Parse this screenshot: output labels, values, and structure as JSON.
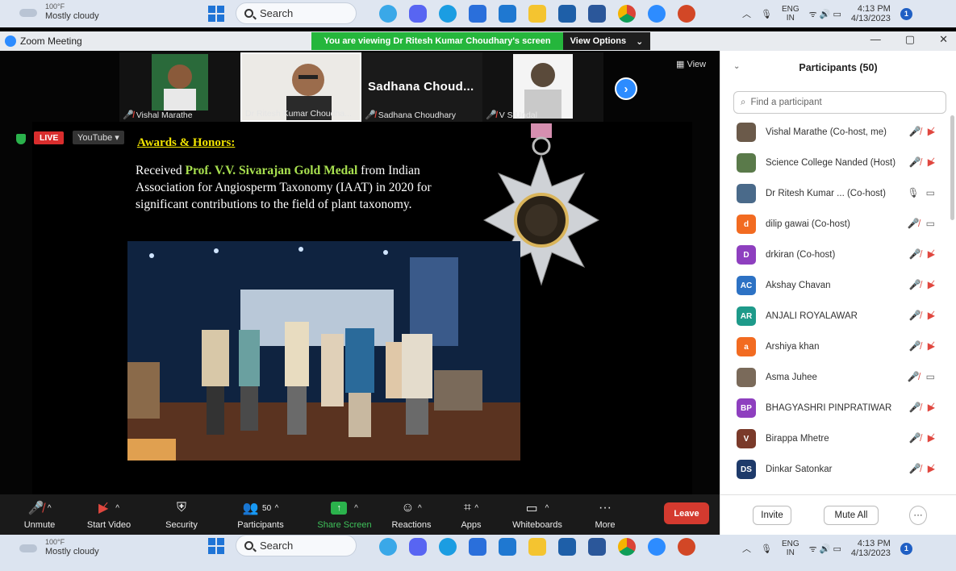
{
  "taskbar": {
    "weather_temp": "100°F",
    "weather_desc": "Mostly cloudy",
    "search_placeholder": "Search",
    "lang_top": "ENG",
    "lang_bottom": "IN",
    "time": "4:13 PM",
    "date": "4/13/2023",
    "notif_count": "1",
    "app_icons": [
      "bing-icon",
      "discord-icon",
      "edge-icon",
      "store-icon",
      "mail-icon",
      "files-icon",
      "launcher-icon",
      "word-icon",
      "chrome-icon",
      "zoom-icon",
      "powerpoint-icon"
    ]
  },
  "titlebar": {
    "title": "Zoom Meeting",
    "banner": "You are viewing Dr Ritesh Kumar Choudhary's screen",
    "view_options": "View Options",
    "controls": [
      "—",
      "▢",
      "✕"
    ]
  },
  "gallery": {
    "thumbs": [
      {
        "name": "Vishal Marathe"
      },
      {
        "name": "Dr Ritesh Kumar Choudha..."
      },
      {
        "name": "Sadhana Choudhary",
        "display": "Sadhana Choud..."
      },
      {
        "name": "V S.Undal"
      }
    ],
    "view_label": "View"
  },
  "shared": {
    "live": "LIVE",
    "youtube": "YouTube",
    "title": "Awards & Honors:",
    "text_pre": "Received ",
    "text_gold": "Prof. V.V. Sivarajan Gold Medal",
    "text_post": " from Indian Association for Angiosperm Taxonomy (IAAT) in 2020 for significant contributions to the field of plant taxonomy."
  },
  "toolbar": {
    "unmute": "Unmute",
    "start_video": "Start Video",
    "security": "Security",
    "participants": "Participants",
    "participants_count": "50",
    "share_screen": "Share Screen",
    "reactions": "Reactions",
    "apps": "Apps",
    "whiteboards": "Whiteboards",
    "more": "More",
    "leave": "Leave"
  },
  "panel": {
    "title": "Participants (50)",
    "find_placeholder": "Find a participant",
    "participants": [
      {
        "name": "Vishal Marathe (Co-host, me)",
        "initials": "",
        "color": "#6b5a4a",
        "mic": "off",
        "cam": "off"
      },
      {
        "name": "Science College Nanded (Host)",
        "initials": "",
        "color": "#5a7a4a",
        "mic": "off",
        "cam": "off"
      },
      {
        "name": "Dr Ritesh Kumar ... (Co-host)",
        "initials": "",
        "color": "#4a6a8a",
        "mic": "on",
        "cam": "on"
      },
      {
        "name": "dilip gawai (Co-host)",
        "initials": "d",
        "color": "#f26b21",
        "mic": "off",
        "cam": "on"
      },
      {
        "name": "drkiran (Co-host)",
        "initials": "D",
        "color": "#8e3fbf",
        "mic": "off",
        "cam": "off"
      },
      {
        "name": "Akshay Chavan",
        "initials": "AC",
        "color": "#2d72c4",
        "mic": "off",
        "cam": "off"
      },
      {
        "name": "ANJALI ROYALAWAR",
        "initials": "AR",
        "color": "#1e9a8a",
        "mic": "off",
        "cam": "off"
      },
      {
        "name": "Arshiya khan",
        "initials": "a",
        "color": "#f26b21",
        "mic": "off",
        "cam": "off"
      },
      {
        "name": "Asma Juhee",
        "initials": "",
        "color": "#7a6a5a",
        "mic": "off",
        "cam": "on"
      },
      {
        "name": "BHAGYASHRI PINPRATIWAR",
        "initials": "BP",
        "color": "#8e3fbf",
        "mic": "off",
        "cam": "off"
      },
      {
        "name": "Birappa Mhetre",
        "initials": "V",
        "color": "#7a3a2a",
        "mic": "off",
        "cam": "off"
      },
      {
        "name": "Dinkar Satonkar",
        "initials": "DS",
        "color": "#1e3a6a",
        "mic": "off",
        "cam": "off"
      }
    ],
    "invite": "Invite",
    "mute_all": "Mute All",
    "more": "···"
  }
}
